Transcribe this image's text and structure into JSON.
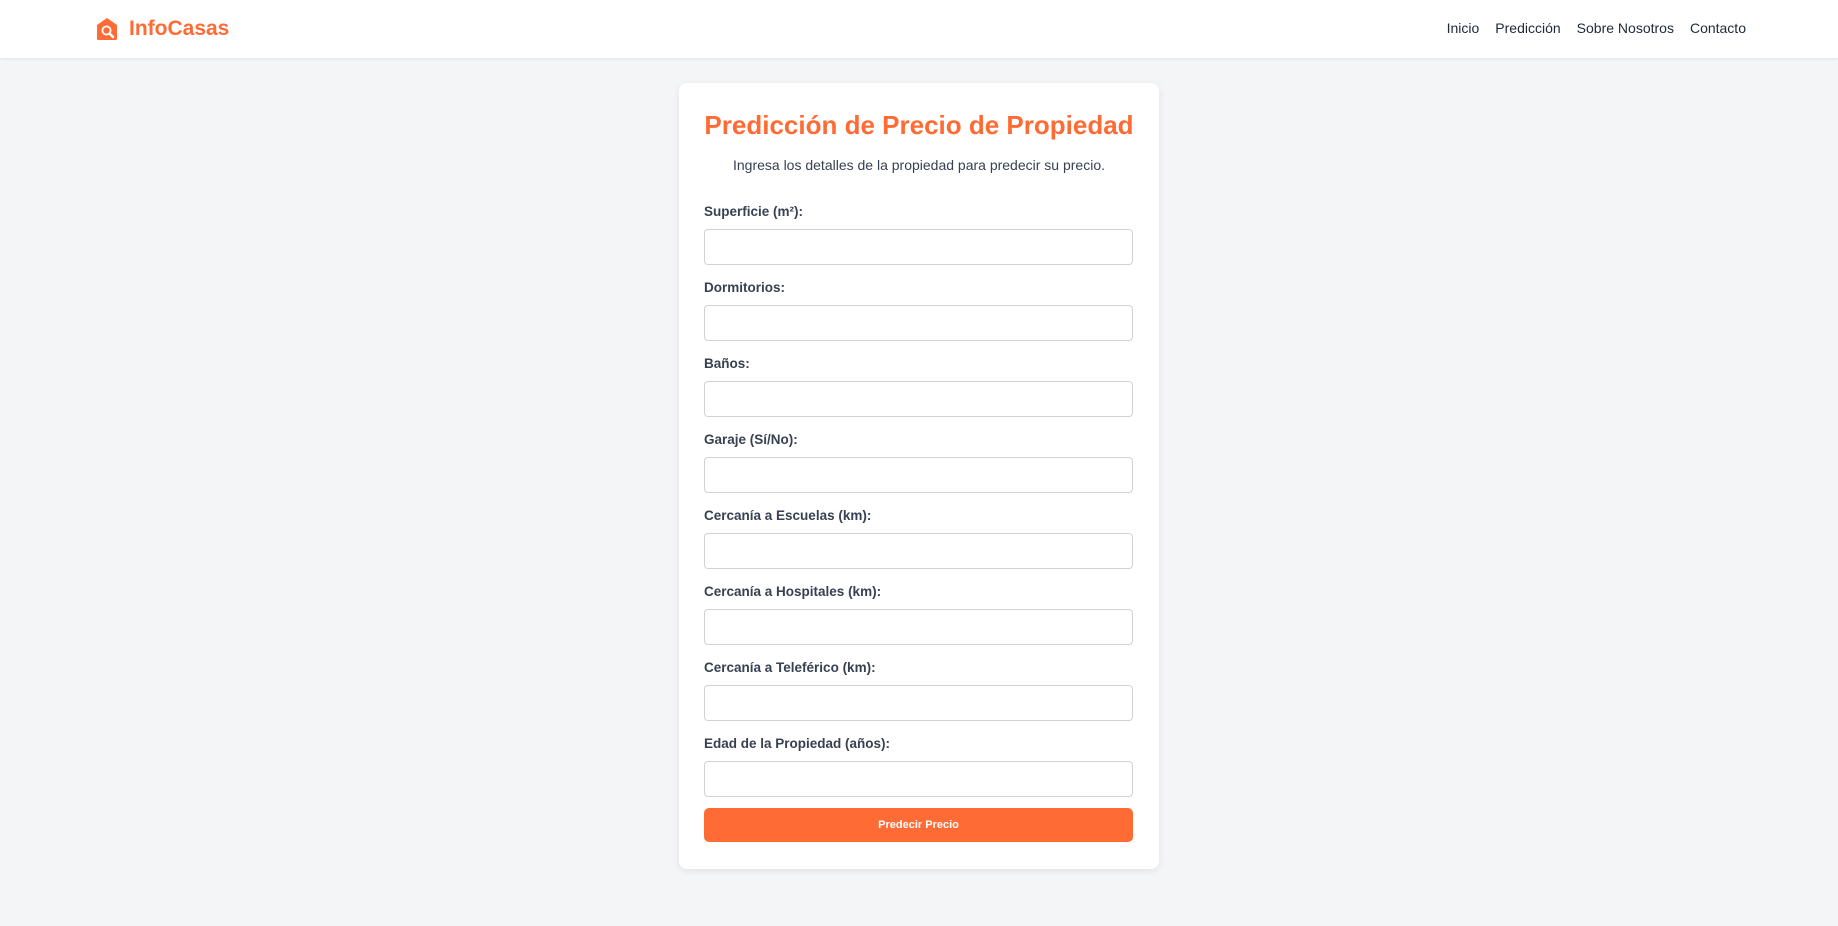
{
  "brand": {
    "name": "InfoCasas",
    "color": "#ff6b35"
  },
  "nav": {
    "items": [
      {
        "label": "Inicio"
      },
      {
        "label": "Predicción"
      },
      {
        "label": "Sobre Nosotros"
      },
      {
        "label": "Contacto"
      }
    ]
  },
  "form_card": {
    "title": "Predicción de Precio de Propiedad",
    "subtitle": "Ingresa los detalles de la propiedad para predecir su precio.",
    "fields": [
      {
        "label": "Superficie (m²):",
        "value": "",
        "placeholder": ""
      },
      {
        "label": "Dormitorios:",
        "value": "",
        "placeholder": ""
      },
      {
        "label": "Baños:",
        "value": "",
        "placeholder": ""
      },
      {
        "label": "Garaje (Sí/No):",
        "value": "",
        "placeholder": ""
      },
      {
        "label": "Cercanía a Escuelas (km):",
        "value": "",
        "placeholder": ""
      },
      {
        "label": "Cercanía a Hospitales (km):",
        "value": "",
        "placeholder": ""
      },
      {
        "label": "Cercanía a Teleférico (km):",
        "value": "",
        "placeholder": ""
      },
      {
        "label": "Edad de la Propiedad (años):",
        "value": "",
        "placeholder": ""
      }
    ],
    "submit_label": "Predecir Precio"
  },
  "icons": {
    "brand_icon": "house-search-icon"
  },
  "colors": {
    "accent": "#ff6b35",
    "background": "#f4f5f7"
  }
}
